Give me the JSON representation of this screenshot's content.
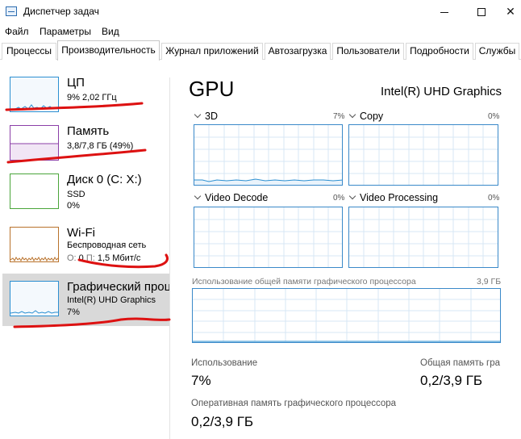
{
  "window": {
    "title": "Диспетчер задач",
    "minimize_icon": "minimize-icon",
    "maximize_icon": "maximize-icon",
    "close_glyph": "✕"
  },
  "menu": {
    "items": [
      "Файл",
      "Параметры",
      "Вид"
    ]
  },
  "tabs": [
    {
      "label": "Процессы",
      "active": false
    },
    {
      "label": "Производительность",
      "active": true
    },
    {
      "label": "Журнал приложений",
      "active": false
    },
    {
      "label": "Автозагрузка",
      "active": false
    },
    {
      "label": "Пользователи",
      "active": false
    },
    {
      "label": "Подробности",
      "active": false
    },
    {
      "label": "Службы",
      "active": false
    }
  ],
  "sidebar": {
    "items": [
      {
        "title": "ЦП",
        "line1": "9%  2,02 ГГц",
        "line2": "",
        "color": "#2b8fd1",
        "selected": false
      },
      {
        "title": "Память",
        "line1": "3,8/7,8 ГБ (49%)",
        "line2": "",
        "color": "#8b3fa8",
        "selected": false
      },
      {
        "title": "Диск 0 (C: X:)",
        "line1": "SSD",
        "line2": "0%",
        "color": "#4aa53a",
        "selected": false
      },
      {
        "title": "Wi-Fi",
        "line1": "Беспроводная сеть",
        "line2_prefix": "О: ",
        "line2_o": "0",
        "line2_mid": " П: ",
        "line2_p": "1,5 Мбит/с",
        "color": "#b9722b",
        "selected": false
      },
      {
        "title": "Графический процессор",
        "line1": "Intel(R) UHD Graphics",
        "line2": "7%",
        "color": "#2b8fd1",
        "selected": true
      }
    ]
  },
  "main": {
    "title": "GPU",
    "model": "Intel(R) UHD Graphics",
    "engines": [
      {
        "name": "3D",
        "percent": "7%"
      },
      {
        "name": "Copy",
        "percent": "0%"
      },
      {
        "name": "Video Decode",
        "percent": "0%"
      },
      {
        "name": "Video Processing",
        "percent": "0%"
      }
    ],
    "shared_memory": {
      "label": "Использование общей памяти графического процессора",
      "max": "3,9 ГБ"
    },
    "stats": {
      "usage_label": "Использование",
      "usage_value": "7%",
      "shared_label": "Общая память гра",
      "shared_value": "0,2/3,9 ГБ",
      "gpu_mem_label": "Оперативная память графического процессора",
      "gpu_mem_value": "0,2/3,9 ГБ"
    }
  },
  "colors": {
    "graph_border": "#3a89c9",
    "grid": "#d7e7f4",
    "annotation": "#dd1111"
  }
}
